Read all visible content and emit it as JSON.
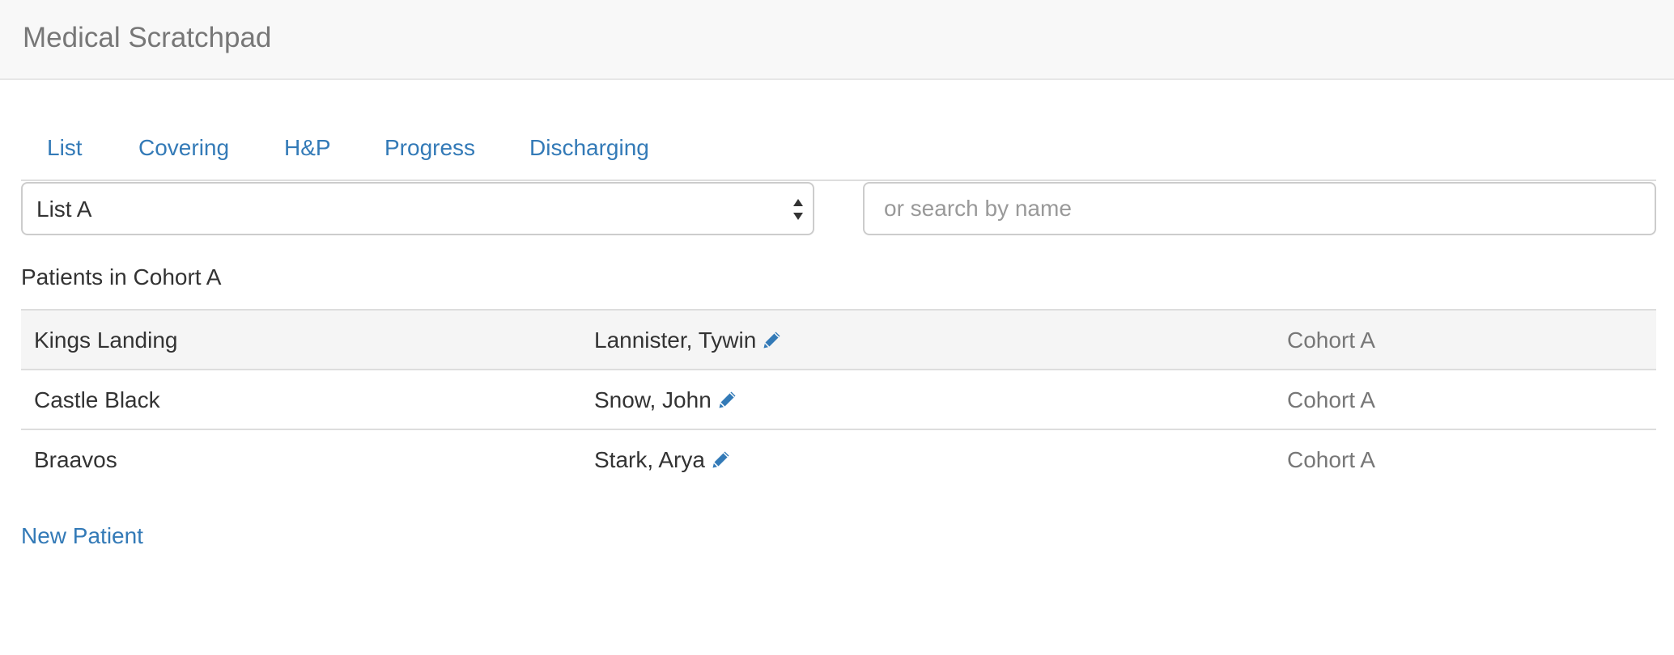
{
  "app": {
    "title": "Medical Scratchpad"
  },
  "tabs": [
    {
      "label": "List"
    },
    {
      "label": "Covering"
    },
    {
      "label": "H&P"
    },
    {
      "label": "Progress"
    },
    {
      "label": "Discharging"
    }
  ],
  "list_select": {
    "selected": "List A"
  },
  "search": {
    "placeholder": "or search by name",
    "value": ""
  },
  "section": {
    "title": "Patients in Cohort A"
  },
  "patients": [
    {
      "location": "Kings Landing",
      "name": "Lannister, Tywin",
      "cohort": "Cohort A",
      "edit_icon": "pencil-icon"
    },
    {
      "location": "Castle Black",
      "name": "Snow, John",
      "cohort": "Cohort A",
      "edit_icon": "pencil-icon"
    },
    {
      "location": "Braavos",
      "name": "Stark, Arya",
      "cohort": "Cohort A",
      "edit_icon": "pencil-icon"
    }
  ],
  "actions": {
    "new_patient": "New Patient"
  },
  "colors": {
    "link": "#337ab7",
    "navbar_bg": "#f8f8f8",
    "muted": "#777777"
  }
}
